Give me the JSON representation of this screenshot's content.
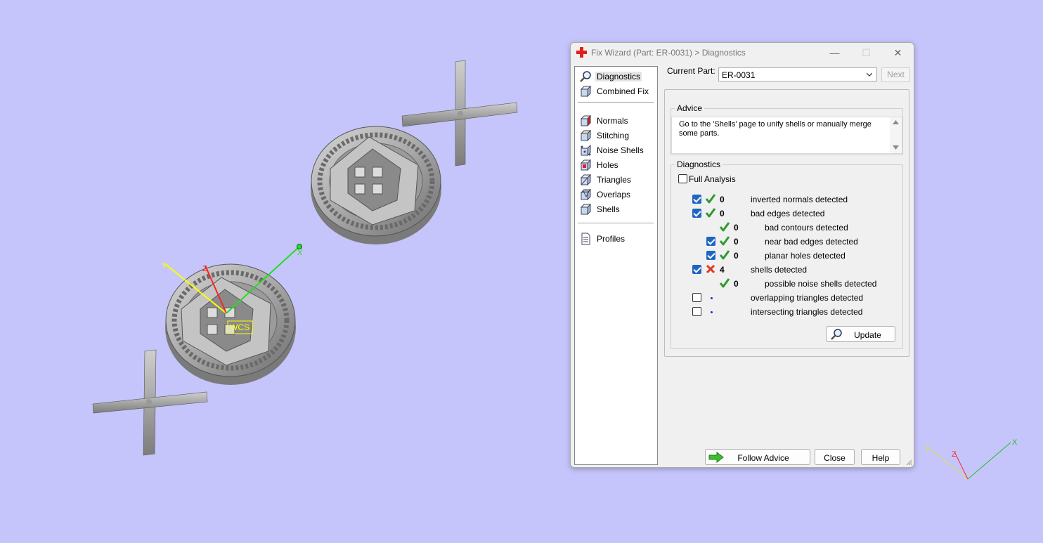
{
  "window": {
    "title": "Fix Wizard (Part: ER-0031) > Diagnostics",
    "minimize_label": "—",
    "maximize_label": "☐",
    "close_label": "✕"
  },
  "nav": {
    "items": [
      {
        "label": "Diagnostics",
        "icon": "magnifier-icon",
        "selected": true
      },
      {
        "label": "Combined Fix",
        "icon": "cube-icon"
      },
      {
        "label": "Normals",
        "icon": "normals-icon"
      },
      {
        "label": "Stitching",
        "icon": "stitching-icon"
      },
      {
        "label": "Noise Shells",
        "icon": "noise-shells-icon"
      },
      {
        "label": "Holes",
        "icon": "holes-icon"
      },
      {
        "label": "Triangles",
        "icon": "triangles-icon"
      },
      {
        "label": "Overlaps",
        "icon": "overlaps-icon"
      },
      {
        "label": "Shells",
        "icon": "shells-icon"
      },
      {
        "label": "Profiles",
        "icon": "document-icon"
      }
    ]
  },
  "current_part": {
    "label": "Current Part:",
    "value": "ER-0031"
  },
  "next_label": "Next",
  "advice": {
    "caption": "Advice",
    "text": "Go to the 'Shells' page to unify shells or manually merge some parts."
  },
  "diagnostics": {
    "caption": "Diagnostics",
    "full_analysis_label": "Full Analysis",
    "full_analysis_checked": false,
    "rows": [
      {
        "checkbox": true,
        "checked": true,
        "status": "ok",
        "count": "0",
        "text": "inverted normals detected",
        "indent": 0
      },
      {
        "checkbox": true,
        "checked": true,
        "status": "ok",
        "count": "0",
        "text": "bad edges detected",
        "indent": 0
      },
      {
        "checkbox": false,
        "checked": false,
        "status": "ok",
        "count": "0",
        "text": "bad contours detected",
        "indent": 1
      },
      {
        "checkbox": true,
        "checked": true,
        "status": "ok",
        "count": "0",
        "text": "near bad edges detected",
        "indent": 1
      },
      {
        "checkbox": true,
        "checked": true,
        "status": "ok",
        "count": "0",
        "text": "planar holes detected",
        "indent": 1
      },
      {
        "checkbox": true,
        "checked": true,
        "status": "error",
        "count": "4",
        "text": "shells detected",
        "indent": 0
      },
      {
        "checkbox": false,
        "checked": false,
        "status": "ok",
        "count": "0",
        "text": "possible noise shells detected",
        "indent": 1
      },
      {
        "checkbox": true,
        "checked": false,
        "status": "none",
        "count": "",
        "text": "overlapping triangles detected",
        "indent": 0
      },
      {
        "checkbox": true,
        "checked": false,
        "status": "none",
        "count": "",
        "text": "intersecting triangles detected",
        "indent": 0
      }
    ],
    "update_label": "Update"
  },
  "footer": {
    "follow_advice_label": "Follow Advice",
    "close_label": "Close",
    "help_label": "Help"
  },
  "viewport": {
    "wcs_label": "WCS",
    "axis_labels": {
      "x": "X",
      "y": "Y",
      "z": "Z"
    },
    "colors": {
      "background": "#c5c5fb",
      "x_axis": "#22dd22",
      "y_axis": "#ffff00",
      "z_axis": "#ff3333"
    }
  }
}
